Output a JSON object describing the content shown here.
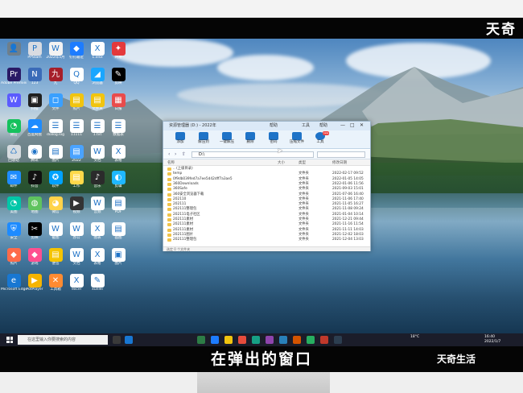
{
  "subtitle": "在弹出的窗口",
  "brand": {
    "top": "天奇",
    "bottom": "天奇生活"
  },
  "desktop_icons": [
    {
      "label": "",
      "color": "#6e7f8c",
      "glyph": "👤"
    },
    {
      "label": "PPStam",
      "color": "#d8dbe1",
      "glyph": "P"
    },
    {
      "label": "2022年5月",
      "color": "#f2f2f2",
      "glyph": "W"
    },
    {
      "label": "钉钉最近",
      "color": "#1d7cff",
      "glyph": "◆"
    },
    {
      "label": "1.xlsx",
      "color": "#ffffff",
      "glyph": "X"
    },
    {
      "label": "网易",
      "color": "#e4393c",
      "glyph": "✦"
    },
    {
      "label": "Adobe Premiere",
      "color": "#2a1a65",
      "glyph": "Pr"
    },
    {
      "label": "123",
      "color": "#3b6bb8",
      "glyph": "N"
    },
    {
      "label": "九",
      "color": "#a61f2a",
      "glyph": "九"
    },
    {
      "label": "QQ",
      "color": "#ffffff",
      "glyph": "Q"
    },
    {
      "label": "浏览器",
      "color": "#1aa6ff",
      "glyph": "◢"
    },
    {
      "label": "剪映",
      "color": "#000000",
      "glyph": "✎"
    },
    {
      "label": "",
      "color": "#5b5bff",
      "glyph": "W"
    },
    {
      "label": "扫描",
      "color": "#202020",
      "glyph": "▣"
    },
    {
      "label": "文件",
      "color": "#3aa0ff",
      "glyph": "◻"
    },
    {
      "label": "照片",
      "color": "#f1c40f",
      "glyph": "▤"
    },
    {
      "label": "文件夹",
      "color": "#f1c40f",
      "glyph": "▤"
    },
    {
      "label": "日报",
      "color": "#e94c4c",
      "glyph": "▦"
    },
    {
      "label": "微信",
      "color": "#15c15d",
      "glyph": "◔"
    },
    {
      "label": "百度网盘",
      "color": "#1f8cff",
      "glyph": "☁"
    },
    {
      "label": "dialog.log",
      "color": "#ffffff",
      "glyph": "☰"
    },
    {
      "label": "11111",
      "color": "#ffffff",
      "glyph": "☰"
    },
    {
      "label": "1.txt",
      "color": "#ffffff",
      "glyph": "☰"
    },
    {
      "label": "数据表",
      "color": "#ffffff",
      "glyph": "☰"
    },
    {
      "label": "回收站",
      "color": "#d7dce0",
      "glyph": "♺"
    },
    {
      "label": "腾讯",
      "color": "#ffffff",
      "glyph": "◉"
    },
    {
      "label": "图片",
      "color": "#ffffff",
      "glyph": "▤"
    },
    {
      "label": "2022",
      "color": "#4aa3ff",
      "glyph": "▤"
    },
    {
      "label": "文档",
      "color": "#ffffff",
      "glyph": "W"
    },
    {
      "label": "表格",
      "color": "#ffffff",
      "glyph": "X"
    },
    {
      "label": "邮件",
      "color": "#1f8cff",
      "glyph": "✉"
    },
    {
      "label": "抖音",
      "color": "#111111",
      "glyph": "♪"
    },
    {
      "label": "软件",
      "color": "#00a2ff",
      "glyph": "✪"
    },
    {
      "label": "工作",
      "color": "#ffd94a",
      "glyph": "▤"
    },
    {
      "label": "音乐",
      "color": "#2b2b2b",
      "glyph": "♪"
    },
    {
      "label": "剪辑",
      "color": "#1fb8ff",
      "glyph": "◐"
    },
    {
      "label": "美图",
      "color": "#00c7a8",
      "glyph": "◔"
    },
    {
      "label": "地图",
      "color": "#5fc35f",
      "glyph": "◍"
    },
    {
      "label": "微信",
      "color": "#ffd34a",
      "glyph": "◕"
    },
    {
      "label": "视频",
      "color": "#333333",
      "glyph": "▶"
    },
    {
      "label": "音频",
      "color": "#ffffff",
      "glyph": "W"
    },
    {
      "label": "PDF",
      "color": "#ffffff",
      "glyph": "▤"
    },
    {
      "label": "安全",
      "color": "#1d8bff",
      "glyph": "⛨"
    },
    {
      "label": "剪映",
      "color": "#000000",
      "glyph": "✂"
    },
    {
      "label": "截图",
      "color": "#ffffff",
      "glyph": "W"
    },
    {
      "label": "办公",
      "color": "#ffffff",
      "glyph": "W"
    },
    {
      "label": "图表",
      "color": "#ffffff",
      "glyph": "X"
    },
    {
      "label": "画图",
      "color": "#ffffff",
      "glyph": "▤"
    },
    {
      "label": "照片",
      "color": "#ff6b4a",
      "glyph": "◆"
    },
    {
      "label": "游戏",
      "color": "#ff4f90",
      "glyph": "◆"
    },
    {
      "label": "便签",
      "color": "#f5c400",
      "glyph": "▤"
    },
    {
      "label": "文档",
      "color": "#ffffff",
      "glyph": "W"
    },
    {
      "label": "表格",
      "color": "#ffffff",
      "glyph": "X"
    },
    {
      "label": "图片",
      "color": "#ffffff",
      "glyph": "▣"
    },
    {
      "label": "Microsoft Edge",
      "color": "#1877d2",
      "glyph": "e"
    },
    {
      "label": "PotPlayer",
      "color": "#f5b400",
      "glyph": "▶"
    },
    {
      "label": "工具箱",
      "color": "#ff8b32",
      "glyph": "✕"
    },
    {
      "label": "excel",
      "color": "#ffffff",
      "glyph": "X"
    },
    {
      "label": "xunlei",
      "color": "#ffffff",
      "glyph": "✎"
    }
  ],
  "window": {
    "title": "资源管理器 (D:) - 2022年",
    "menus": [
      "帮助",
      "工具",
      "帮助"
    ],
    "toolbar": [
      {
        "label": "添加"
      },
      {
        "label": "解压到"
      },
      {
        "label": "一键解压"
      },
      {
        "label": "删除"
      },
      {
        "label": "密码"
      },
      {
        "label": "压缩文件"
      },
      {
        "label": "工具"
      }
    ],
    "address": "D:\\",
    "headers": {
      "name": "名称",
      "size": "大小",
      "type": "类型",
      "modified": "修改日期"
    },
    "rows": [
      {
        "name": ".. (上级目录)",
        "type": "",
        "date": ""
      },
      {
        "name": "temp",
        "type": "文件夹",
        "date": "2022-02-17 09:52"
      },
      {
        "name": "0f9db039fed7a7ee5d42dff7a3ae5",
        "type": "文件夹",
        "date": "2022-01-05 14:05"
      },
      {
        "name": "360Downloads",
        "type": "文件夹",
        "date": "2022-01-06 11:56"
      },
      {
        "name": "360Safe",
        "type": "文件夹",
        "date": "2021-09-03 15:01"
      },
      {
        "name": "360安全浏览器下载",
        "type": "文件夹",
        "date": "2021-07-06 16:40"
      },
      {
        "name": "202110",
        "type": "文件夹",
        "date": "2021-11-06 17:40"
      },
      {
        "name": "202111",
        "type": "文件夹",
        "date": "2021-11-05 16:27"
      },
      {
        "name": "202111整理包",
        "type": "文件夹",
        "date": "2021-11-08 09:24"
      },
      {
        "name": "202111电子社区",
        "type": "文件夹",
        "date": "2021-01-04 10:14"
      },
      {
        "name": "202111素材",
        "type": "文件夹",
        "date": "2021-12-21 09:44"
      },
      {
        "name": "202111素材",
        "type": "文件夹",
        "date": "2021-11-16 11:54"
      },
      {
        "name": "202111素材",
        "type": "文件夹",
        "date": "2021-11-11 14:03"
      },
      {
        "name": "202111图片",
        "type": "文件夹",
        "date": "2021-12-02 18:03"
      },
      {
        "name": "202111整理包",
        "type": "文件夹",
        "date": "2021-12-04 13:03"
      }
    ],
    "status": "选定 0 个文件夹"
  },
  "taskbar": {
    "search_placeholder": "在这里输入你要搜索的内容",
    "tray_temp": "18°C",
    "clock": "16:40",
    "date": "2022/1/7"
  }
}
